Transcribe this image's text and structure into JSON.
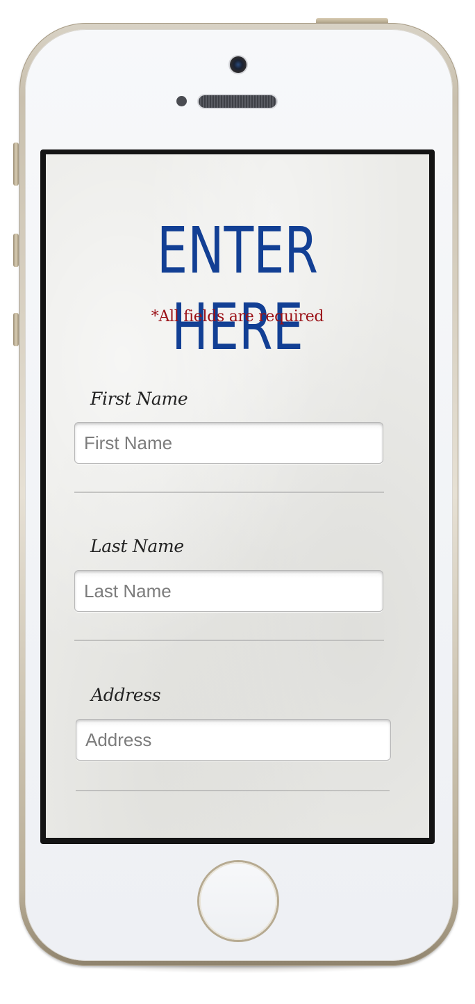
{
  "form": {
    "title": "ENTER HERE",
    "required_note": "*All fields are required",
    "fields": [
      {
        "label": "First Name",
        "placeholder": "First Name",
        "value": ""
      },
      {
        "label": "Last Name",
        "placeholder": "Last Name",
        "value": ""
      },
      {
        "label": "Address",
        "placeholder": "Address",
        "value": ""
      }
    ]
  },
  "colors": {
    "title": "#123f94",
    "required_note": "#9a1016",
    "phone_frame": "#c9c0ae"
  }
}
